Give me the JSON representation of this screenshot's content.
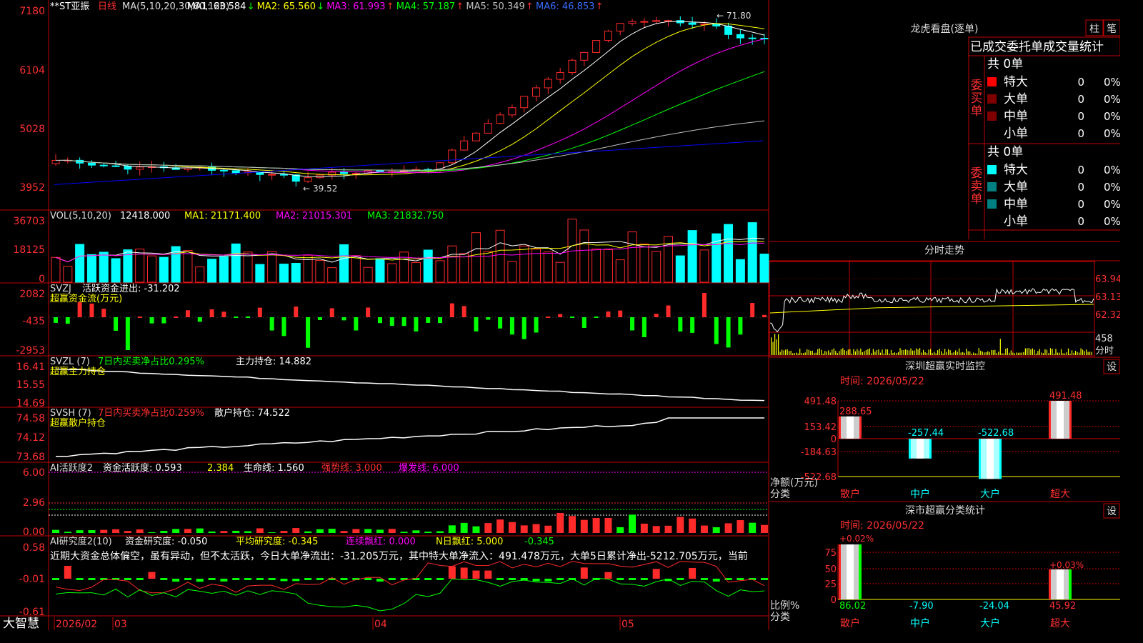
{
  "colors": {
    "up": "#ff2a2a",
    "down": "#00ffff",
    "border": "#c00000",
    "text": "#dddddd",
    "ma1": "#ffffff",
    "ma2": "#ffff00",
    "ma3": "#ff00ff",
    "ma4": "#00ff00",
    "ma5": "#c0c0c0",
    "ma6": "#0000ff",
    "axis_label": "#ff3030"
  },
  "main_panel": {
    "title": "**ST亚振",
    "period": "日线",
    "ma_params": "MA(5,10,20,30,60,120)",
    "ma_values": [
      {
        "label": "MA1: 63.584",
        "arrow": "↓"
      },
      {
        "label": "MA2: 65.560",
        "arrow": "↓"
      },
      {
        "label": "MA3: 61.993",
        "arrow": "↑"
      },
      {
        "label": "MA4: 57.187",
        "arrow": "↑"
      },
      {
        "label": "MA5: 50.349",
        "arrow": "↑"
      },
      {
        "label": "MA6: 46.853",
        "arrow": "↑"
      }
    ],
    "y_labels": [
      "7180",
      "6104",
      "5028",
      "3952"
    ],
    "high_marker": "71.80",
    "low_marker": "39.52"
  },
  "vol_panel": {
    "header": "VOL(5,10,20)",
    "value": "12418.000",
    "ma": [
      "MA1: 21171.400",
      "MA2: 21015.301",
      "MA3: 21832.750"
    ],
    "y_labels": [
      "36703",
      "18125",
      "0"
    ]
  },
  "svzj_panel": {
    "header": "SVZJ",
    "label": "活跃资金进出: -31.202",
    "sub": "超赢资金流(万元)",
    "y_labels": [
      "2082",
      "-435",
      "-2953"
    ]
  },
  "svzl_panel": {
    "header": "SVZL (7)",
    "label1": "7日内买卖净占比0.295%",
    "label2": "主力持仓: 14.882",
    "sub": "超赢主力持仓",
    "y_labels": [
      "16.41",
      "15.55",
      "14.69"
    ]
  },
  "svsh_panel": {
    "header": "SVSH (7)",
    "label1": "7日内买卖净占比0.259%",
    "label2": "散户持仓: 74.522",
    "sub": "超赢散户持仓",
    "y_labels": [
      "74.58",
      "74.12",
      "73.68"
    ]
  },
  "ai_active_panel": {
    "header": "AI活跃度2",
    "label1": "资金活跃度: 0.593",
    "label2": "2.384",
    "label3": "生命线: 1.560",
    "label4": "强势线: 3.000",
    "label5": "爆发线: 6.000",
    "y_labels": [
      "6.00",
      "2.96",
      "0.00"
    ]
  },
  "ai_research_panel": {
    "header": "AI研究度2(10)",
    "label1": "资金研究度: -0.050",
    "label2": "平均研究度: -0.345",
    "label3": "连续飘红: 0.000",
    "label4": "N日飘红: 5.000",
    "label5": "-0.345",
    "comment": "近期大资金总体偏空，虽有异动，但不太活跃，今日大单净流出：-31.205万元，其中特大单净流入：491.478万元，大单5日累计净出-5212.705万元，当前",
    "y_labels": [
      "0.58",
      "-0.01",
      "-0.61"
    ]
  },
  "date_bar": {
    "brand": "大智慧",
    "labels": [
      "2026/02",
      "03",
      "04",
      "05"
    ]
  },
  "longhu": {
    "title": "龙虎看盘(逐单)",
    "btn_bar": "柱",
    "btn_pen": "笔",
    "tabs": [
      "已成交",
      "委托单",
      "成交量统计"
    ],
    "buy_label": "委买单",
    "sell_label": "委卖单",
    "buy_total": "共 0单",
    "sell_total": "共 0单",
    "rows": [
      {
        "name": "特大",
        "count": "0",
        "pct": "0%"
      },
      {
        "name": "大单",
        "count": "0",
        "pct": "0%"
      },
      {
        "name": "中单",
        "count": "0",
        "pct": "0%"
      },
      {
        "name": "小单",
        "count": "0",
        "pct": "0%"
      }
    ]
  },
  "intraday": {
    "title": "分时走势",
    "y_labels": [
      "63.94",
      "63.13",
      "62.32"
    ],
    "vol_label": "458",
    "vol_unit": "分时"
  },
  "sz_monitor": {
    "title": "深圳超赢实时监控",
    "btn": "设",
    "time": "时间: 2026/05/22",
    "y_labels": [
      "491.48",
      "153.42",
      "0",
      "-184.63",
      "-522.68"
    ],
    "unit": "净额(万元)",
    "cat_label": "分类",
    "categories": [
      "散户",
      "中户",
      "大户",
      "超大"
    ],
    "values": [
      288.65,
      -257.44,
      -522.68,
      491.48
    ],
    "value_labels": [
      "288.65",
      "-257.44",
      "-522.68",
      "491.48"
    ]
  },
  "sz_stats": {
    "title": "深市超赢分类统计",
    "btn": "设",
    "time": "时间: 2026/05/22",
    "y_labels": [
      "75",
      "50",
      "25",
      "0"
    ],
    "pct_labels": [
      "+0.02%",
      "+0.03%"
    ],
    "ratio_label": "比例%",
    "cat_label": "分类",
    "categories": [
      "散户",
      "中户",
      "大户",
      "超大"
    ],
    "values": [
      "86.02",
      "-7.90",
      "-24.04",
      "45.92"
    ]
  }
}
